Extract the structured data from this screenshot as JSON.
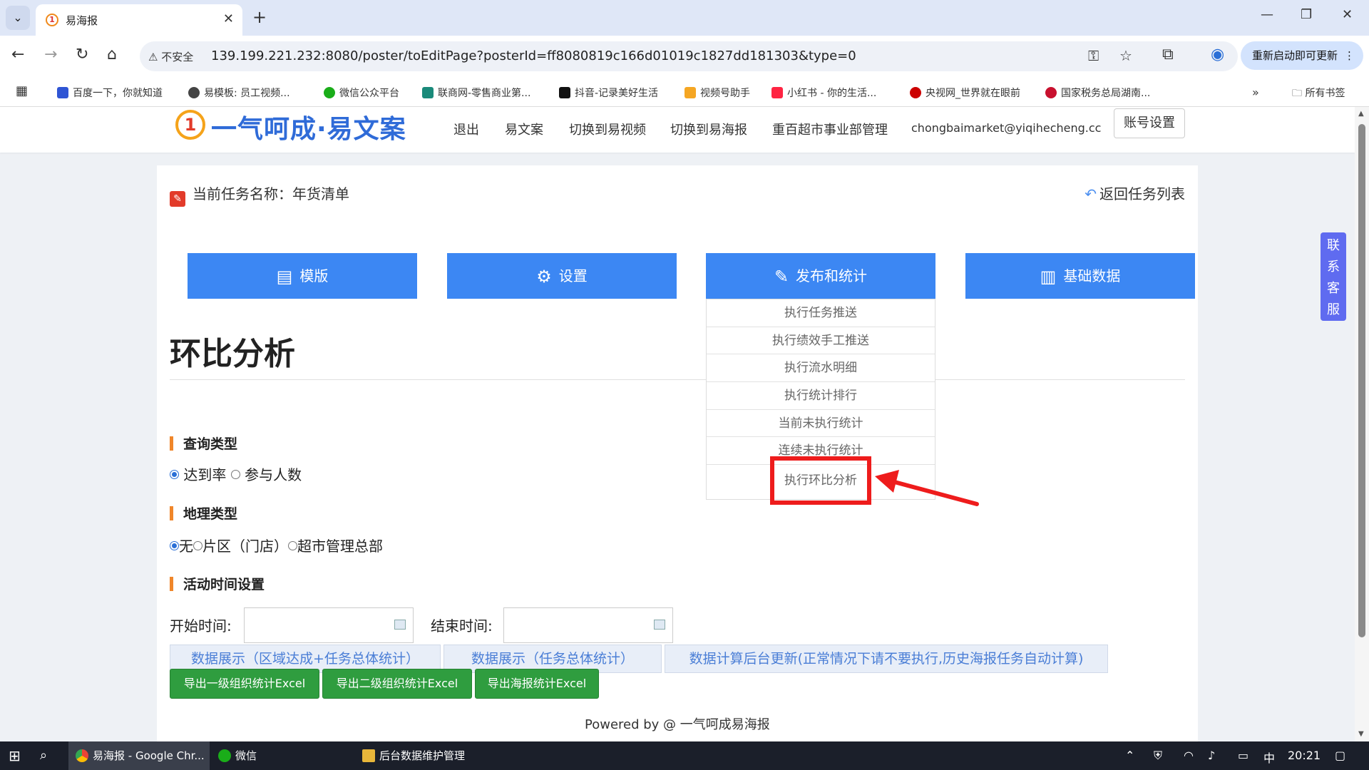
{
  "browser": {
    "tab_title": "易海报",
    "tab_favicon": "1",
    "security_label": "不安全",
    "url": "139.199.221.232:8080/poster/toEditPage?posterId=ff8080819c166d01019c1827dd181303&type=0",
    "update_button": "重新启动即可更新",
    "bookmarks": [
      {
        "label": "百度一下，你就知道",
        "color": "#2f55d4"
      },
      {
        "label": "易模板: 员工视频...",
        "color": "#444444"
      },
      {
        "label": "微信公众平台",
        "color": "#1aad19"
      },
      {
        "label": "联商网-零售商业第...",
        "color": "#1a8a7a"
      },
      {
        "label": "抖音-记录美好生活",
        "color": "#111111"
      },
      {
        "label": "视频号助手",
        "color": "#f5a623"
      },
      {
        "label": "小红书 - 你的生活...",
        "color": "#ff2442"
      },
      {
        "label": "央视网_世界就在眼前",
        "color": "#cc0000"
      },
      {
        "label": "国家税务总局湖南...",
        "color": "#c8102e"
      }
    ],
    "all_bookmarks": "所有书签"
  },
  "header": {
    "logo_mark": "1",
    "logo_text": "一气呵成·易文案",
    "nav": [
      "退出",
      "易文案",
      "切换到易视频",
      "切换到易海报",
      "重百超市事业部管理",
      "chongbaimarket@yiqihecheng.cc"
    ],
    "account_button": "账号设置"
  },
  "main": {
    "task_label": "当前任务名称：年货清单",
    "back_link": "返回任务列表",
    "tabs": [
      {
        "label": "模版",
        "icon": "layout-icon"
      },
      {
        "label": "设置",
        "icon": "gear-icon"
      },
      {
        "label": "发布和统计",
        "icon": "edit-icon"
      },
      {
        "label": "基础数据",
        "icon": "data-icon"
      }
    ],
    "dropdown": [
      "执行任务推送",
      "执行绩效手工推送",
      "执行流水明细",
      "执行统计排行",
      "当前未执行统计",
      "连续未执行统计",
      "执行环比分析"
    ],
    "page_title": "环比分析",
    "query_type": {
      "heading": "查询类型",
      "options": [
        "达到率",
        "参与人数"
      ],
      "selected": 0
    },
    "geo_type": {
      "heading": "地理类型",
      "options": [
        "无",
        "片区（门店）",
        "超市管理总部"
      ],
      "selected": 0
    },
    "time_setting": {
      "heading": "活动时间设置",
      "start_label": "开始时间:",
      "end_label": "结束时间:",
      "start_value": "",
      "end_value": ""
    },
    "action_links": [
      "数据展示（区域达成+任务总体统计）",
      "数据展示（任务总体统计）",
      "数据计算后台更新(正常情况下请不要执行,历史海报任务自动计算)"
    ],
    "export_buttons": [
      "导出一级组织统计Excel",
      "导出二级组织统计Excel",
      "导出海报统计Excel"
    ],
    "footer": "Powered by @ 一气呵成易海报"
  },
  "side_service": [
    "联",
    "系",
    "客",
    "服"
  ],
  "taskbar": {
    "items": [
      "易海报 - Google Chr...",
      "微信",
      "后台数据维护管理"
    ],
    "ime": "中",
    "time": "20:21"
  },
  "colors": {
    "primary_blue": "#3c87f3",
    "accent_orange": "#f0862a",
    "highlight_red": "#ee1c1c",
    "export_green": "#2f9d3f"
  }
}
